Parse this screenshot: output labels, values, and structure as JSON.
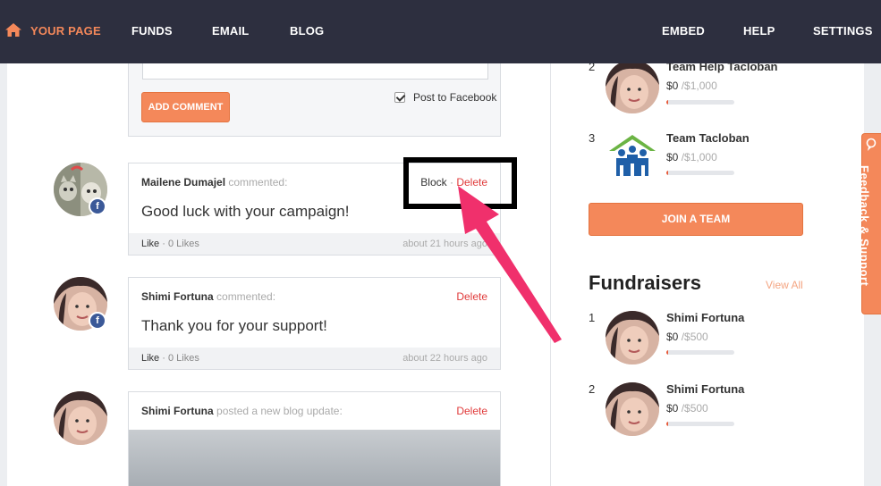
{
  "nav": {
    "your_page": "YOUR PAGE",
    "funds": "FUNDS",
    "email": "EMAIL",
    "blog": "BLOG",
    "embed": "EMBED",
    "help": "HELP",
    "settings": "SETTINGS",
    "active_color": "#f4885a"
  },
  "comment_form": {
    "add_comment": "ADD COMMENT",
    "post_to_facebook": "Post to Facebook",
    "post_to_facebook_checked": true
  },
  "comments": [
    {
      "author": "Mailene Dumajel",
      "action": "commented:",
      "block": "Block",
      "separator": "·",
      "delete": "Delete",
      "text": "Good luck with your campaign!",
      "like": "Like",
      "likes": "· 0 Likes",
      "time": "about 21 hours ago"
    },
    {
      "author": "Shimi Fortuna",
      "action": "commented:",
      "delete": "Delete",
      "text": "Thank you for your support!",
      "like": "Like",
      "likes": "· 0 Likes",
      "time": "about 22 hours ago"
    },
    {
      "author": "Shimi Fortuna",
      "action": "posted a new blog update:",
      "delete": "Delete"
    }
  ],
  "teams": [
    {
      "rank": "2",
      "name": "Team Help Tacloban",
      "raised": "$0",
      "goal": "/$1,000",
      "progress": 0.02
    },
    {
      "rank": "3",
      "name": "Team Tacloban",
      "raised": "$0",
      "goal": "/$1,000",
      "progress": 0.02
    }
  ],
  "join_team": "JOIN A TEAM",
  "fundraisers": {
    "title": "Fundraisers",
    "view_all": "View All",
    "items": [
      {
        "rank": "1",
        "name": "Shimi Fortuna",
        "raised": "$0",
        "goal": "/$500",
        "progress": 0.02
      },
      {
        "rank": "2",
        "name": "Shimi Fortuna",
        "raised": "$0",
        "goal": "/$500",
        "progress": 0.02
      }
    ]
  },
  "feedback": "Feedback & Support",
  "colors": {
    "nav_bg": "#2d2f3f",
    "accent": "#f4885a",
    "delete": "#e03a3a",
    "arrow": "#f0306c",
    "facebook": "#3b5998"
  }
}
